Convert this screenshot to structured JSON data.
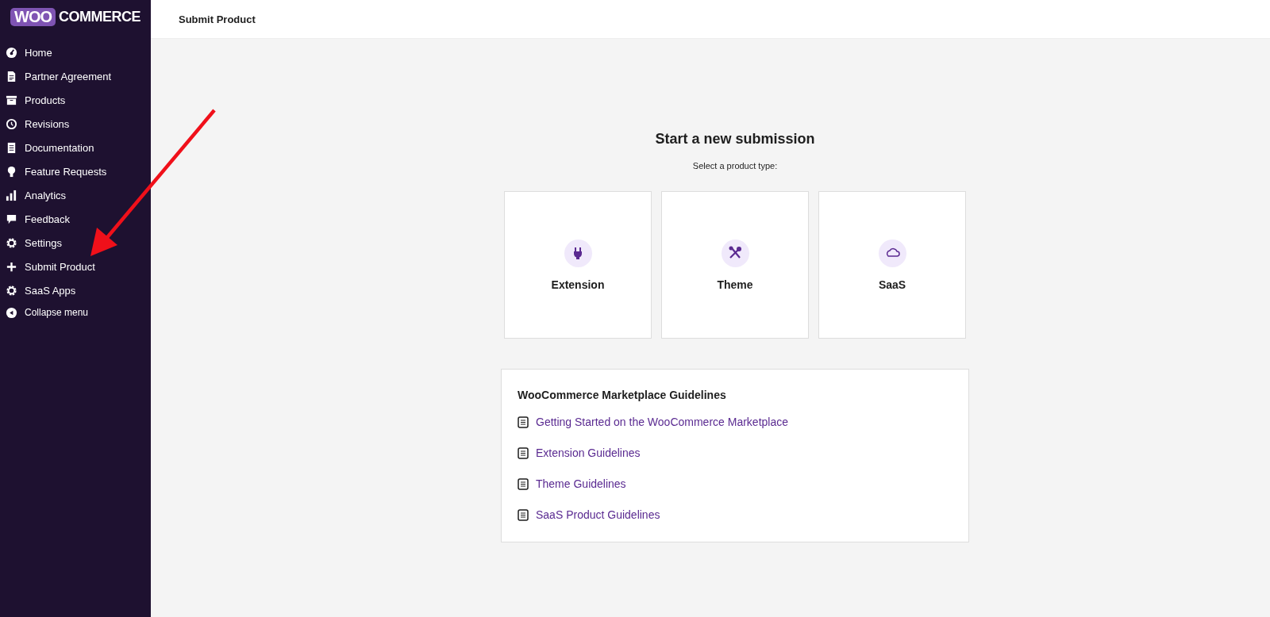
{
  "sidebar": {
    "logo": {
      "badge": "WOO",
      "text": "COMMERCE"
    },
    "items": [
      {
        "label": "Home",
        "selected": false
      },
      {
        "label": "Partner Agreement",
        "selected": false
      },
      {
        "label": "Products",
        "selected": false
      },
      {
        "label": "Revisions",
        "selected": false
      },
      {
        "label": "Documentation",
        "selected": false
      },
      {
        "label": "Feature Requests",
        "selected": false
      },
      {
        "label": "Analytics",
        "selected": false
      },
      {
        "label": "Feedback",
        "selected": false
      },
      {
        "label": "Settings",
        "selected": false
      },
      {
        "label": "Submit Product",
        "selected": false
      },
      {
        "label": "SaaS Apps",
        "selected": false
      },
      {
        "label": "Collapse menu",
        "selected": false
      }
    ]
  },
  "header": {
    "title": "Submit Product"
  },
  "submission": {
    "title": "Start a new submission",
    "subtitle": "Select a product type:",
    "types": [
      {
        "label": "Extension"
      },
      {
        "label": "Theme"
      },
      {
        "label": "SaaS"
      }
    ]
  },
  "guidelines": {
    "title": "WooCommerce Marketplace Guidelines",
    "links": [
      {
        "label": "Getting Started on the WooCommerce Marketplace"
      },
      {
        "label": "Extension Guidelines"
      },
      {
        "label": "Theme Guidelines"
      },
      {
        "label": "SaaS Product Guidelines"
      }
    ]
  }
}
